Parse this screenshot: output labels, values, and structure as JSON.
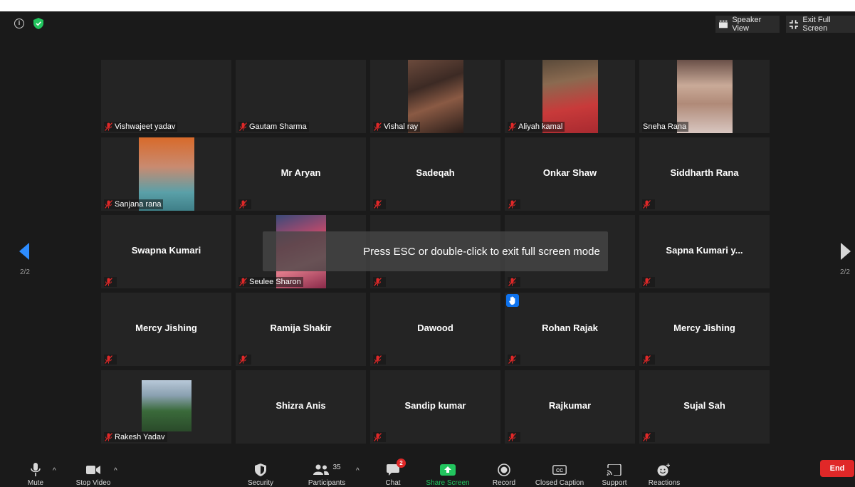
{
  "top_right": {
    "speaker_view": "Speaker View",
    "exit_full_screen": "Exit Full Screen"
  },
  "pagination": {
    "left": "2/2",
    "right": "2/2"
  },
  "participants": [
    {
      "name": "Vishwajeet yadav",
      "video": false,
      "label_mode": "corner",
      "muted": true
    },
    {
      "name": "Gautam Sharma",
      "video": false,
      "label_mode": "corner",
      "muted": true
    },
    {
      "name": "Vishal ray",
      "video": true,
      "label_mode": "corner",
      "muted": true
    },
    {
      "name": "Aliyah kamal",
      "video": true,
      "label_mode": "corner",
      "muted": true
    },
    {
      "name": "Sneha Rana",
      "video": true,
      "label_mode": "corner",
      "muted": false
    },
    {
      "name": "Sanjana rana",
      "video": true,
      "label_mode": "corner",
      "muted": true
    },
    {
      "name": "Mr Aryan",
      "video": false,
      "label_mode": "center",
      "muted": true
    },
    {
      "name": "Sadeqah",
      "video": false,
      "label_mode": "center",
      "muted": true
    },
    {
      "name": "Onkar Shaw",
      "video": false,
      "label_mode": "center",
      "muted": true
    },
    {
      "name": "Siddharth Rana",
      "video": false,
      "label_mode": "center",
      "muted": true
    },
    {
      "name": "Swapna Kumari",
      "video": false,
      "label_mode": "center",
      "muted": true
    },
    {
      "name": "Seulee Sharon",
      "video": true,
      "label_mode": "corner",
      "muted": true
    },
    {
      "name": "",
      "video": false,
      "label_mode": "center",
      "muted": true
    },
    {
      "name": "",
      "video": false,
      "label_mode": "center",
      "muted": true
    },
    {
      "name": "Sapna Kumari y...",
      "video": false,
      "label_mode": "center",
      "muted": true
    },
    {
      "name": "Mercy Jishing",
      "video": false,
      "label_mode": "center",
      "muted": true
    },
    {
      "name": "Ramija Shakir",
      "video": false,
      "label_mode": "center",
      "muted": true
    },
    {
      "name": "Dawood",
      "video": false,
      "label_mode": "center",
      "muted": true
    },
    {
      "name": "Rohan Rajak",
      "video": false,
      "label_mode": "center",
      "muted": true,
      "hand_raised": true
    },
    {
      "name": "Mercy Jishing",
      "video": false,
      "label_mode": "center",
      "muted": true
    },
    {
      "name": "Rakesh Yadav",
      "video": true,
      "label_mode": "corner",
      "muted": true
    },
    {
      "name": "Shizra Anis",
      "video": false,
      "label_mode": "center",
      "muted": true
    },
    {
      "name": "Sandip kumar",
      "video": false,
      "label_mode": "center",
      "muted": true
    },
    {
      "name": "Rajkumar",
      "video": false,
      "label_mode": "center",
      "muted": true
    },
    {
      "name": "Sujal Sah",
      "video": false,
      "label_mode": "center",
      "muted": true
    }
  ],
  "toast": "Press ESC or double-click to exit full screen mode",
  "toolbar": {
    "mute": "Mute",
    "stop_video": "Stop Video",
    "security": "Security",
    "participants": "Participants",
    "participants_count": "35",
    "chat": "Chat",
    "chat_badge": "2",
    "share_screen": "Share Screen",
    "record": "Record",
    "closed_caption": "Closed Caption",
    "support": "Support",
    "reactions": "Reactions",
    "end": "End"
  },
  "colors": {
    "background": "#1a1a1a",
    "tile": "#242424",
    "muted_icon": "#e02828",
    "share_green": "#22c55e",
    "nav_blue": "#2d8cff",
    "end_red": "#e02828"
  }
}
